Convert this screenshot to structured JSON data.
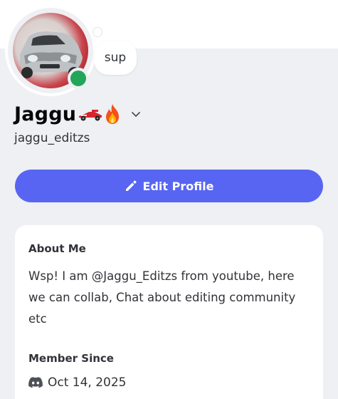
{
  "status_bubble": {
    "text": "sup"
  },
  "profile": {
    "display_name": "Jaggu",
    "username": "jaggu_editzs",
    "status": "online"
  },
  "edit_button": {
    "label": "Edit Profile"
  },
  "about": {
    "title": "About Me",
    "text": "Wsp! I am @Jaggu_Editzs from youtube, here we can collab, Chat about editing community etc"
  },
  "member_since": {
    "title": "Member Since",
    "date": "Oct 14, 2025"
  },
  "colors": {
    "accent": "#5865f2",
    "online": "#23a55a",
    "panel_bg": "#eef0f3"
  },
  "icons": {
    "display_name_emojis": [
      "race-car-icon",
      "fire-icon"
    ],
    "chevron": "chevron-down-icon",
    "edit": "pencil-icon",
    "member_since": "discord-icon"
  }
}
